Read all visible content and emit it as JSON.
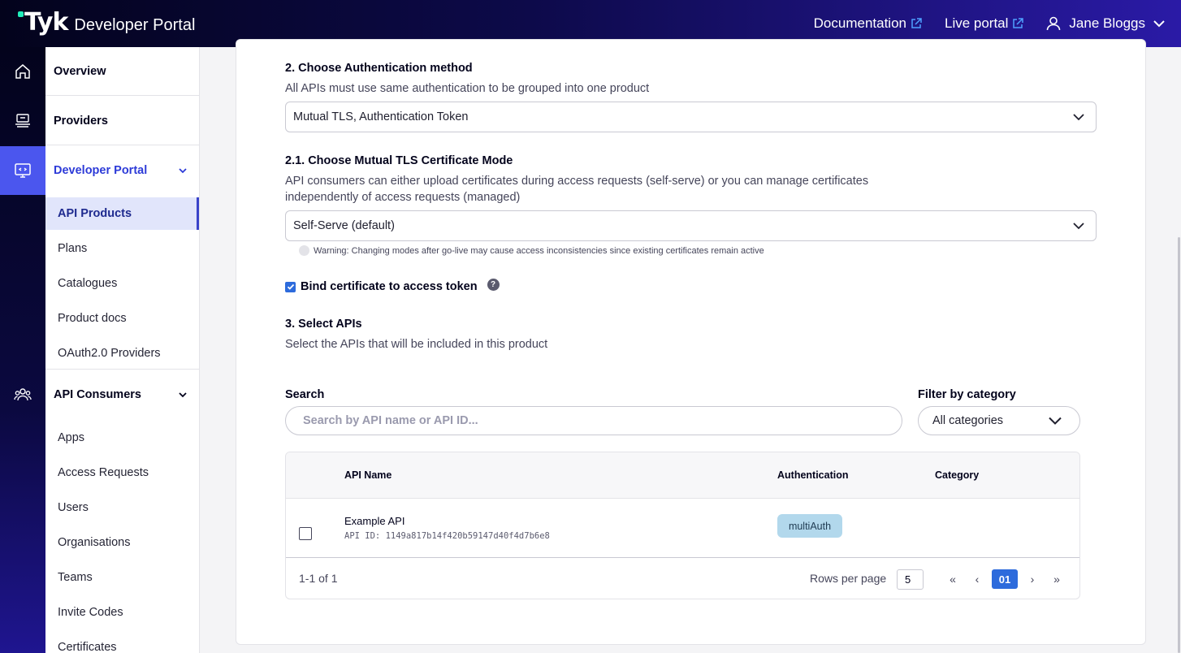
{
  "header": {
    "logo_mark": "Tyk",
    "product_name": "Developer Portal",
    "links": [
      {
        "label": "Documentation",
        "icon": "external-link-icon"
      },
      {
        "label": "Live portal",
        "icon": "external-link-icon"
      }
    ],
    "user_name": "Jane Bloggs"
  },
  "rail": {
    "items": [
      {
        "icon": "home-icon"
      },
      {
        "icon": "providers-icon"
      },
      {
        "icon": "portal-monitor-icon",
        "active": true
      },
      {
        "icon": "users-group-icon"
      }
    ]
  },
  "sidebar": {
    "overview": "Overview",
    "providers": "Providers",
    "developer_portal": "Developer Portal",
    "portal_items": [
      "API Products",
      "Plans",
      "Catalogues",
      "Product docs",
      "OAuth2.0 Providers"
    ],
    "api_consumers": "API Consumers",
    "consumer_items": [
      "Apps",
      "Access Requests",
      "Users",
      "Organisations",
      "Teams",
      "Invite Codes",
      "Certificates"
    ]
  },
  "form": {
    "auth_heading": "2. Choose Authentication method",
    "auth_help": "All APIs must use same authentication to be grouped into one product",
    "auth_value": "Mutual TLS, Authentication Token",
    "mtls_heading": "2.1. Choose Mutual TLS Certificate Mode",
    "mtls_help_line1": "API consumers can either upload certificates during access requests (self-serve) or you can manage certificates",
    "mtls_help_line2": "independently of access requests (managed)",
    "mtls_value": "Self-Serve (default)",
    "warning": "Warning: Changing modes after go-live may cause access inconsistencies since existing certificates remain active",
    "bind_label": "Bind certificate to access token",
    "bind_checked": true,
    "help_glyph": "?",
    "apis_heading": "3. Select APIs",
    "apis_help": "Select the APIs that will be included in this product"
  },
  "search": {
    "label": "Search",
    "placeholder": "Search by API name or API ID..."
  },
  "filter": {
    "label": "Filter by category",
    "value": "All categories"
  },
  "table": {
    "columns": [
      "API Name",
      "Authentication",
      "Category"
    ],
    "rows": [
      {
        "name": "Example API",
        "id": "API ID: 1149a817b14f420b59147d40f4d7b6e8",
        "auth": "multiAuth",
        "category": ""
      }
    ],
    "range": "1-1 of 1",
    "rows_per_page_label": "Rows per page",
    "rows_per_page": "5",
    "pager": {
      "first": "«",
      "prev": "‹",
      "current": "01",
      "next": "›",
      "last": "»"
    }
  },
  "colors": {
    "accent": "#2d3bd8",
    "active_rail": "#4b56ee",
    "checkbox": "#2d6bdc",
    "badge_bg": "#b2d8ec"
  }
}
